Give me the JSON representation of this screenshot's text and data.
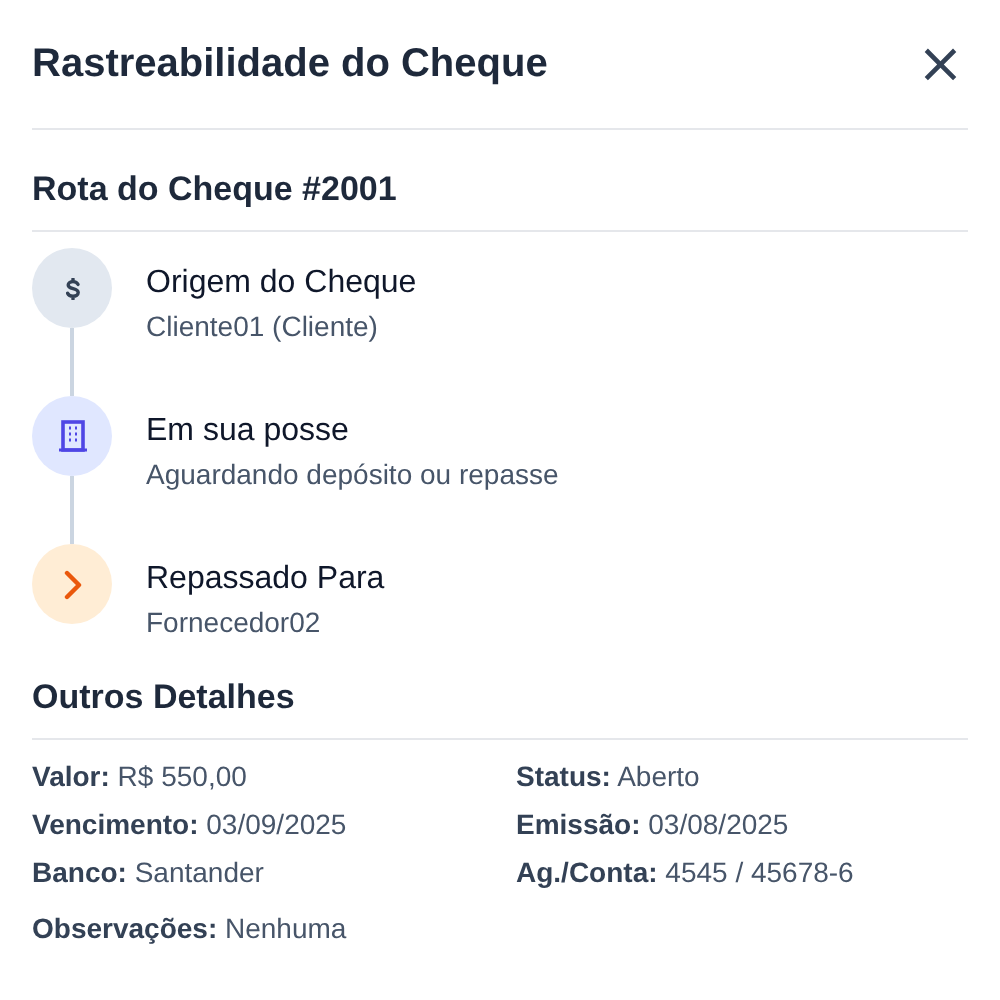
{
  "header": {
    "title": "Rastreabilidade do Cheque",
    "close": "×"
  },
  "route": {
    "title": "Rota do Cheque #2001",
    "steps": [
      {
        "kind": "origin",
        "title": "Origem do Cheque",
        "subtitle": "Cliente01 (Cliente)"
      },
      {
        "kind": "holding",
        "title": "Em sua posse",
        "subtitle": "Aguardando depósito ou repasse"
      },
      {
        "kind": "forwarded",
        "title": "Repassado Para",
        "subtitle": "Fornecedor02"
      }
    ]
  },
  "details": {
    "title": "Outros Detalhes",
    "fields": [
      "**Valor:** R$ 550,00",
      "**Status:** Aberto",
      "**Vencimento:** 03/09/2025",
      "**Emissão:** 03/08/2025",
      "**Banco:** Santander",
      "**Ag./Conta:** 4545 / 45678-6"
    ],
    "notes": "**Observações:** Nenhuma"
  }
}
